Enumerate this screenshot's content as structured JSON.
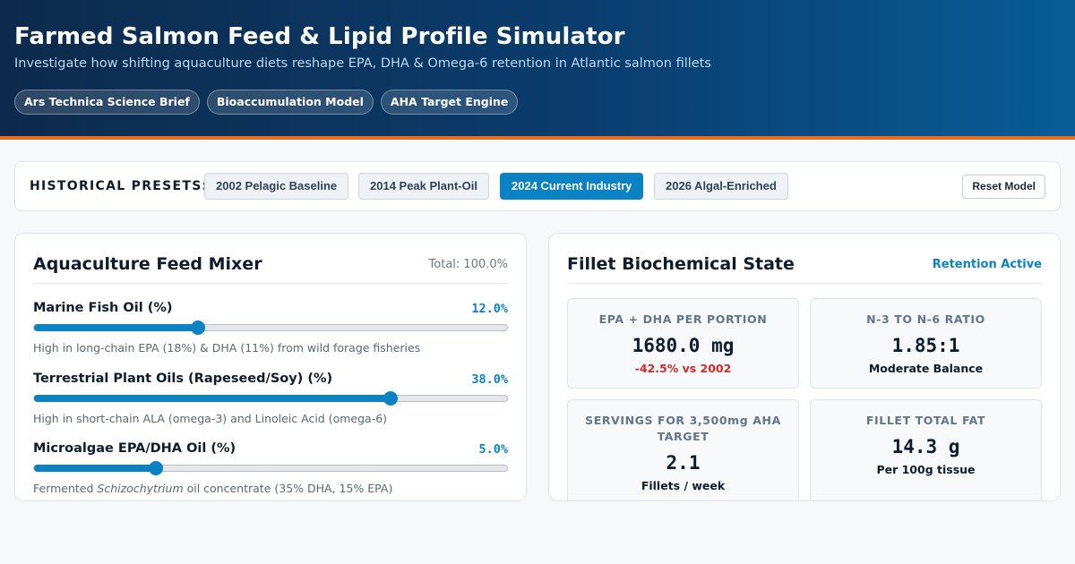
{
  "header": {
    "title": "Farmed Salmon Feed & Lipid Profile Simulator",
    "subtitle": "Investigate how shifting aquaculture diets reshape EPA, DHA & Omega-6 retention in Atlantic salmon fillets",
    "badges": [
      "Ars Technica Science Brief",
      "Bioaccumulation Model",
      "AHA Target Engine"
    ]
  },
  "presets": {
    "label": "HISTORICAL PRESETS:",
    "items": [
      "2002 Pelagic Baseline",
      "2014 Peak Plant-Oil",
      "2024 Current Industry",
      "2026 Algal-Enriched"
    ],
    "active": "2024 Current Industry",
    "reset_label": "Reset Model"
  },
  "mixer": {
    "title": "Aquaculture Feed Mixer",
    "total": "Total: 100.0%",
    "sliders": [
      {
        "label": "Marine Fish Oil (%)",
        "value_text": "12.0%",
        "level": 0.347,
        "desc": "High in long-chain EPA (18%) & DHA (11%) from wild forage fisheries"
      },
      {
        "label": "Terrestrial Plant Oils (Rapeseed/Soy) (%)",
        "value_text": "38.0%",
        "level": 0.753,
        "desc": "High in short-chain ALA (omega-3) and Linoleic Acid (omega-6)"
      },
      {
        "label": "Microalgae EPA/DHA Oil (%)",
        "value_text": "5.0%",
        "level": 0.257,
        "desc_pre": "Fermented ",
        "desc_em": "Schizochytrium",
        "desc_post": " oil concentrate (35% DHA, 15% EPA)"
      }
    ]
  },
  "fillet": {
    "title": "Fillet Biochemical State",
    "status": "Retention Active",
    "stats": [
      {
        "label": "EPA + DHA PER PORTION",
        "value": "1680.0 mg",
        "note": "-42.5% vs 2002",
        "negative": true
      },
      {
        "label": "N-3 TO N-6 RATIO",
        "value": "1.85:1",
        "note": "Moderate Balance",
        "negative": false
      },
      {
        "label": "SERVINGS FOR 3,500mg AHA TARGET",
        "value": "2.1",
        "note": "Fillets / week",
        "negative": false
      },
      {
        "label": "FILLET TOTAL FAT",
        "value": "14.3 g",
        "note": "Per 100g tissue",
        "negative": false
      }
    ]
  },
  "colors": {
    "accent": "#0b82c4",
    "header_start": "#0d2a4c",
    "header_end": "#075c98",
    "header_border": "#ea6c1f",
    "negative": "#dc2626"
  }
}
